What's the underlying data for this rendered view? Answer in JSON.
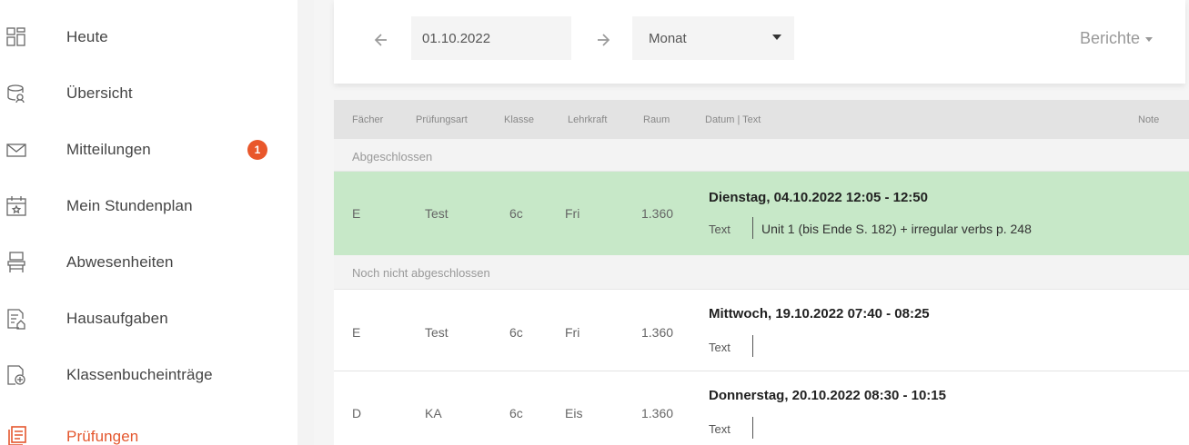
{
  "sidebar": {
    "items": [
      {
        "label": "Heute",
        "icon": "dashboard-grid-icon"
      },
      {
        "label": "Übersicht",
        "icon": "overview-icon"
      },
      {
        "label": "Mitteilungen",
        "icon": "mail-icon",
        "badge": "1"
      },
      {
        "label": "Mein Stundenplan",
        "icon": "calendar-icon"
      },
      {
        "label": "Abwesenheiten",
        "icon": "chair-icon"
      },
      {
        "label": "Hausaufgaben",
        "icon": "homework-icon"
      },
      {
        "label": "Klassenbucheinträge",
        "icon": "classbook-icon"
      },
      {
        "label": "Prüfungen",
        "icon": "exams-icon",
        "active": true
      }
    ]
  },
  "toolbar": {
    "date_value": "01.10.2022",
    "period_value": "Monat",
    "reports_label": "Berichte"
  },
  "table": {
    "headers": {
      "subject": "Fächer",
      "exam_type": "Prüfungsart",
      "class": "Klasse",
      "teacher": "Lehrkraft",
      "room": "Raum",
      "date_text": "Datum | Text",
      "grade": "Note"
    },
    "groups": [
      {
        "label": "Abgeschlossen",
        "rows": [
          {
            "subject": "E",
            "type": "Test",
            "class": "6c",
            "teacher": "Fri",
            "room": "1.360",
            "datetime": "Dienstag, 04.10.2022 12:05 - 12:50",
            "text_label": "Text",
            "text": "Unit 1 (bis Ende S. 182) + irregular verbs p. 248"
          }
        ]
      },
      {
        "label": "Noch nicht abgeschlossen",
        "rows": [
          {
            "subject": "E",
            "type": "Test",
            "class": "6c",
            "teacher": "Fri",
            "room": "1.360",
            "datetime": "Mittwoch, 19.10.2022 07:40 - 08:25",
            "text_label": "Text",
            "text": ""
          },
          {
            "subject": "D",
            "type": "KA",
            "class": "6c",
            "teacher": "Eis",
            "room": "1.360",
            "datetime": "Donnerstag, 20.10.2022 08:30 - 10:15",
            "text_label": "Text",
            "text": ""
          }
        ]
      }
    ]
  },
  "colors": {
    "accent": "#e4572e",
    "done_row": "#c7e8c8",
    "badge": "#e9572b"
  }
}
